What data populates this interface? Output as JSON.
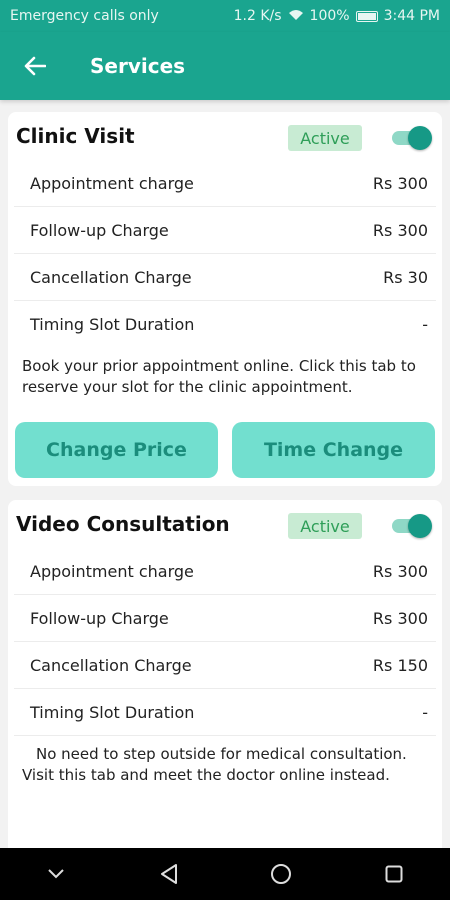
{
  "status_bar": {
    "left_text": "Emergency calls only",
    "speed": "1.2 K/s",
    "battery": "100%",
    "time": "3:44 PM"
  },
  "header": {
    "title": "Services"
  },
  "cards": [
    {
      "title": "Clinic Visit",
      "badge": "Active",
      "toggle_on": true,
      "rows": [
        {
          "label": "Appointment charge",
          "value": "Rs 300"
        },
        {
          "label": "Follow-up Charge",
          "value": "Rs 300"
        },
        {
          "label": "Cancellation Charge",
          "value": "Rs 30"
        },
        {
          "label": "Timing Slot Duration",
          "value": "-"
        }
      ],
      "description": "Book your prior appointment online. Click this tab to reserve your slot for the clinic appointment.",
      "buttons": {
        "change_price": "Change Price",
        "time_change": "Time Change"
      }
    },
    {
      "title": "Video Consultation",
      "badge": "Active",
      "toggle_on": true,
      "rows": [
        {
          "label": "Appointment charge",
          "value": "Rs 300"
        },
        {
          "label": "Follow-up Charge",
          "value": "Rs 300"
        },
        {
          "label": "Cancellation Charge",
          "value": "Rs 150"
        },
        {
          "label": "Timing Slot Duration",
          "value": "-"
        }
      ],
      "description": "No need to step outside for medical consultation. Visit this tab and meet the doctor online instead."
    }
  ],
  "colors": {
    "primary": "#1aa58f",
    "button": "#72dfcf",
    "badge_bg": "#c8ebd3",
    "badge_text": "#2e9e58"
  },
  "nav": {
    "icons": [
      "chevron-down-icon",
      "back-triangle-icon",
      "home-circle-icon",
      "recents-square-icon"
    ]
  }
}
